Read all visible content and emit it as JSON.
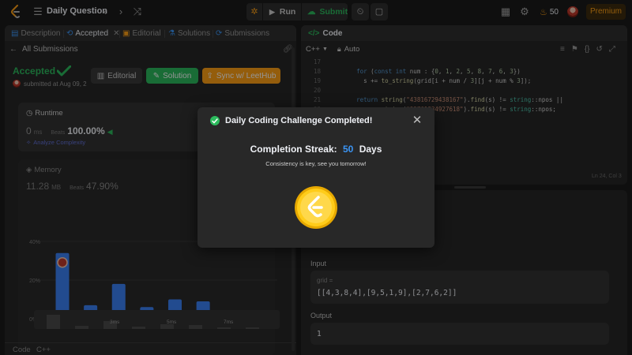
{
  "topbar": {
    "title": "Daily Question",
    "run_label": "Run",
    "submit_label": "Submit",
    "streak_count": "50",
    "premium_label": "Premium"
  },
  "left": {
    "tabs": [
      {
        "label": "Description"
      },
      {
        "label": "Accepted"
      },
      {
        "label": "Editorial"
      },
      {
        "label": "Solutions"
      },
      {
        "label": "Submissions"
      }
    ],
    "back_label": "All Submissions",
    "status": "Accepted",
    "submitted": "submitted at Aug 09, 2",
    "buttons": {
      "editorial": "Editorial",
      "solution": "Solution",
      "sync": "Sync w/ LeetHub"
    },
    "runtime": {
      "title": "Runtime",
      "value": "0",
      "unit": "ms",
      "beats_label": "Beats",
      "beats_value": "100.00%",
      "analyze": "Analyze Complexity"
    },
    "memory": {
      "title": "Memory",
      "value": "11.28",
      "unit": "MB",
      "beats_label": "Beats",
      "beats_value": "47.90%"
    },
    "bottom_tabs": [
      "Code",
      "C++"
    ]
  },
  "chart_data": {
    "type": "bar",
    "categories": [
      "1ms",
      "2ms",
      "3ms",
      "4ms",
      "5ms",
      "6ms",
      "7ms",
      "8ms"
    ],
    "values": [
      34,
      7,
      18,
      6,
      10,
      9,
      3,
      3
    ],
    "ylim": [
      0,
      40
    ],
    "yticks": [
      "40%",
      "20%",
      "0%"
    ],
    "xtick_labels": [
      "",
      "2ms",
      "3ms",
      "4ms",
      "5ms",
      "6ms",
      "7ms",
      "8ms"
    ],
    "highlight_index": 0,
    "bar_color": "#3b82f6",
    "mini_labels": [
      "3ms",
      "5ms",
      "7ms"
    ]
  },
  "code": {
    "title": "Code",
    "language": "C++",
    "mode": "Auto",
    "lines": [
      {
        "n": "17",
        "html": ""
      },
      {
        "n": "18",
        "html": "    <span class=\"kw\">for</span> (<span class=\"kw\">const int</span> num : {<span class=\"num\">0</span>, <span class=\"num\">1</span>, <span class=\"num\">2</span>, <span class=\"num\">5</span>, <span class=\"num\">8</span>, <span class=\"num\">7</span>, <span class=\"num\">6</span>, <span class=\"num\">3</span>})"
      },
      {
        "n": "19",
        "html": "      s += <span class=\"fn\">to_string</span>(grid[i + num / <span class=\"num\">3</span>][j + num % <span class=\"num\">3</span>]);"
      },
      {
        "n": "20",
        "html": ""
      },
      {
        "n": "21",
        "html": "    <span class=\"kw\">return</span> <span class=\"fn\">string</span>(<span class=\"str\">\"43816729438167\"</span>).<span class=\"fn\">find</span>(s) != <span class=\"ns\">string</span>::npos ||"
      },
      {
        "n": "22",
        "html": "           <span class=\"fn\">string</span>(<span class=\"str\">\"92761834927618\"</span>).<span class=\"fn\">find</span>(s) != <span class=\"ns\">string</span>::npos;"
      },
      {
        "n": "23",
        "html": ""
      }
    ],
    "status": "Ln 24, Col 3"
  },
  "testcase": {
    "input_label": "Input",
    "var_name": "grid =",
    "var_value": "[[4,3,8,4],[9,5,1,9],[2,7,6,2]]",
    "output_label": "Output",
    "output_value": "1"
  },
  "modal": {
    "title": "Daily Coding Challenge Completed!",
    "streak_label": "Completion Streak:",
    "streak_value": "50",
    "streak_unit": "Days",
    "subtitle": "Consistency is key, see you tomorrow!"
  }
}
